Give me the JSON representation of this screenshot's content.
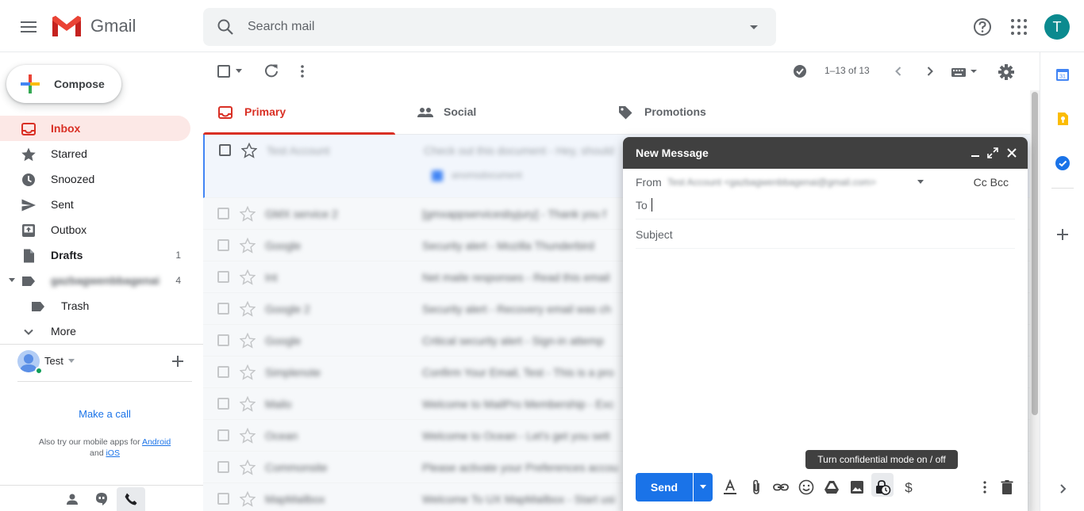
{
  "app": {
    "brand": "Gmail",
    "account_initial": "T",
    "accent_color": "#d93025",
    "avatar_color": "#0b8a8f"
  },
  "search": {
    "placeholder": "Search mail"
  },
  "sidebar": {
    "compose_label": "Compose",
    "items": [
      {
        "label": "Inbox",
        "icon": "inbox-icon",
        "count": "",
        "active": true
      },
      {
        "label": "Starred",
        "icon": "star-icon",
        "count": ""
      },
      {
        "label": "Snoozed",
        "icon": "clock-icon",
        "count": ""
      },
      {
        "label": "Sent",
        "icon": "send-icon",
        "count": ""
      },
      {
        "label": "Outbox",
        "icon": "outbox-icon",
        "count": ""
      },
      {
        "label": "Drafts",
        "icon": "draft-icon",
        "count": "1"
      },
      {
        "label": "gazbagwenbbagenai",
        "icon": "label-icon",
        "count": "4"
      },
      {
        "label": "Trash",
        "icon": "label-icon",
        "count": ""
      },
      {
        "label": "More",
        "icon": "chevron-down-icon",
        "count": ""
      }
    ],
    "hangouts": {
      "user_name": "Test",
      "make_call": "Make a call",
      "mobile_prefix": "Also try our mobile apps for",
      "android_link": "Android",
      "and_text": "and",
      "ios_link": "iOS"
    }
  },
  "toolbar": {
    "pagination": "1–13 of 13"
  },
  "tabs": [
    {
      "label": "Primary",
      "icon": "inbox-icon",
      "active": true
    },
    {
      "label": "Social",
      "icon": "people-icon"
    },
    {
      "label": "Promotions",
      "icon": "tag-icon"
    }
  ],
  "emails": [
    {
      "sender": "Test Account",
      "subject": "Check out this document - Hey, should",
      "attachment": "anomsdocument"
    },
    {
      "sender": "GMX service 2",
      "subject": "[gmxappservicesbyjury] - Thank you f"
    },
    {
      "sender": "Google",
      "subject": "Security alert - Mozilla Thunderbird"
    },
    {
      "sender": "Int",
      "subject": "Net maile responses - Read this email"
    },
    {
      "sender": "Google 2",
      "subject": "Security alert - Recovery email was ch"
    },
    {
      "sender": "Google",
      "subject": "Critical security alert - Sign-in attemp"
    },
    {
      "sender": "Simplenote",
      "subject": "Confirm Your Email, Test - This is a pro"
    },
    {
      "sender": "Mailo",
      "subject": "Welcome to MailPro Membership - Exc"
    },
    {
      "sender": "Ocean",
      "subject": "Welcome to Ocean - Let's get you sett"
    },
    {
      "sender": "Commonsite",
      "subject": "Please activate your Preferences accou"
    },
    {
      "sender": "MapMailbox",
      "subject": "Welcome To UX MapMailbox - Start usi"
    }
  ],
  "compose_window": {
    "title": "New Message",
    "from_label": "From",
    "from_value": "Test Account <gazbagwenbbagenai@gmail.com>",
    "cc_bcc": "Cc Bcc",
    "to_label": "To",
    "subject_placeholder": "Subject",
    "send_label": "Send",
    "tooltip": "Turn confidential mode on / off"
  }
}
